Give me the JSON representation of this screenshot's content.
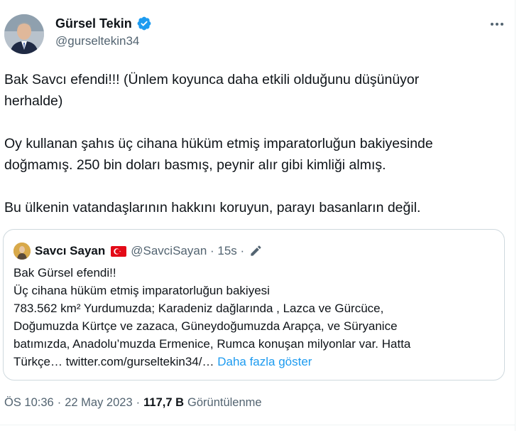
{
  "author": {
    "name": "Gürsel Tekin",
    "handle": "@gurseltekin34",
    "verified_color": "#1d9bf0"
  },
  "tweet": {
    "paragraphs": [
      [
        "Bak Savcı efendi!!! (Ünlem koyunca daha etkili olduğunu düşünüyor",
        "herhalde)"
      ],
      [
        "Oy kullanan şahıs üç cihana hüküm etmiş imparatorluğun bakiyesinde",
        "doğmamış. 250 bin doları basmış, peynir alır gibi kimliği almış."
      ],
      [
        "Bu ülkenin vatandaşlarının hakkını koruyun, parayı basanların değil."
      ]
    ]
  },
  "quote": {
    "name": "Savcı Sayan",
    "flag_icon": "turkey-flag-icon",
    "handle_time": "@SavciSayan · 15s ·",
    "edit_icon": "pencil-icon",
    "lines": [
      "Bak Gürsel efendi!!",
      "Üç cihana hüküm etmiş imparatorluğun bakiyesi",
      "783.562 km² Yurdumuzda; Karadeniz dağlarında , Lazca ve Gürcüce,",
      "Doğumuzda Kürtçe ve zazaca, Güneydoğumuzda Arapça, ve Süryanice",
      "batımızda, Anadolu’muzda Ermenice, Rumca konuşan milyonlar var. Hatta",
      "Türkçe… twitter.com/gurseltekin34/…"
    ],
    "show_more": "Daha fazla göster"
  },
  "meta": {
    "time": "ÖS 10:36",
    "sep1": "·",
    "date": "22 May 2023",
    "sep2": "·",
    "views_count": "117,7 B",
    "views_label": "Görüntülenme"
  },
  "colors": {
    "link": "#1d9bf0",
    "secondary_text": "#536471",
    "border": "#cfd9de"
  }
}
